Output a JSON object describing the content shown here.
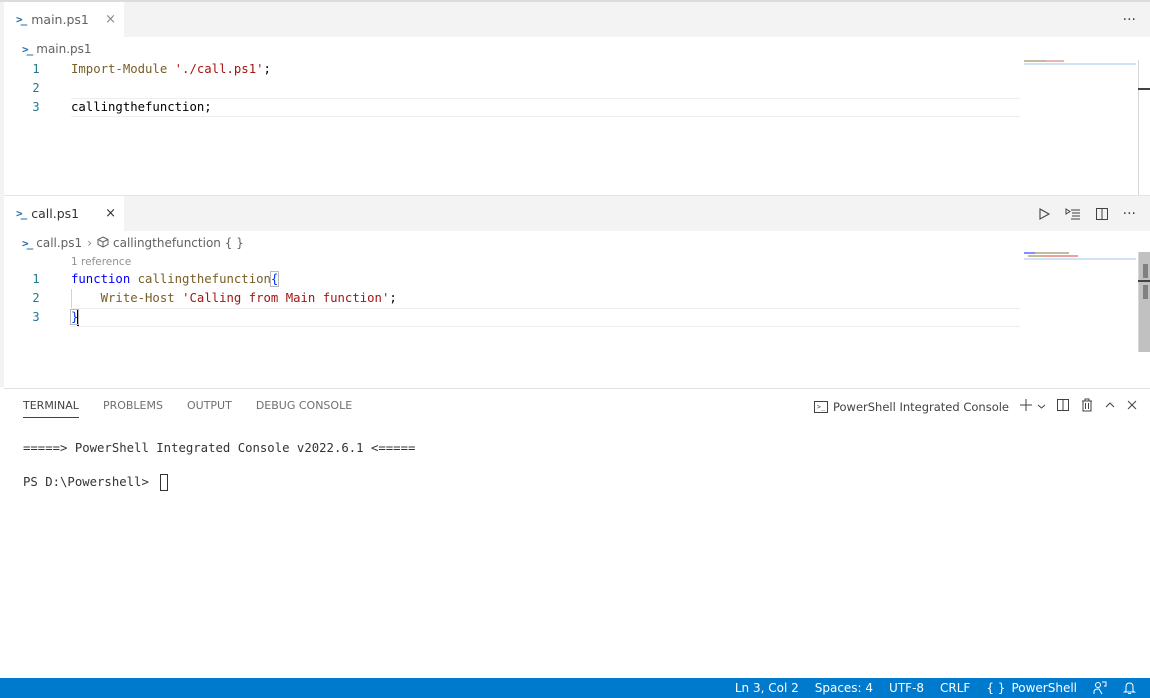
{
  "editor_groups": [
    {
      "tab": {
        "label": "main.ps1",
        "icon": "powershell-icon",
        "close": "×"
      },
      "actions": {
        "more": "···"
      },
      "breadcrumb": [
        {
          "label": "main.ps1",
          "icon": "powershell-icon"
        }
      ],
      "lines": [
        {
          "num": "1",
          "tokens": [
            {
              "t": "Import-Module ",
              "c": "cmd"
            },
            {
              "t": "'./call.ps1'",
              "c": "str"
            },
            {
              "t": ";",
              "c": "plain"
            }
          ]
        },
        {
          "num": "2",
          "tokens": []
        },
        {
          "num": "3",
          "tokens": [
            {
              "t": "callingthefunction;",
              "c": "plain"
            }
          ],
          "current": true
        }
      ]
    },
    {
      "tab": {
        "label": "call.ps1",
        "icon": "powershell-icon",
        "close": "×"
      },
      "actions": {
        "run": "▷",
        "run_selection": "run-selection",
        "split": "split",
        "more": "···"
      },
      "breadcrumb": [
        {
          "label": "call.ps1",
          "icon": "powershell-icon"
        },
        {
          "label": "callingthefunction { }",
          "icon": "symbol-function-icon"
        }
      ],
      "codelens": "1 reference",
      "lines": [
        {
          "num": "1",
          "tokens": [
            {
              "t": "function ",
              "c": "kw"
            },
            {
              "t": "callingthefunction",
              "c": "fn"
            },
            {
              "t": "{",
              "c": "brace"
            }
          ]
        },
        {
          "num": "2",
          "tokens": [
            {
              "t": "    Write-Host ",
              "c": "cmd"
            },
            {
              "t": "'Calling from Main function'",
              "c": "str"
            },
            {
              "t": ";",
              "c": "plain"
            }
          ]
        },
        {
          "num": "3",
          "tokens": [
            {
              "t": "}",
              "c": "brace"
            }
          ],
          "current": true,
          "cursor": true
        }
      ]
    }
  ],
  "panel": {
    "tabs": [
      "TERMINAL",
      "PROBLEMS",
      "OUTPUT",
      "DEBUG CONSOLE"
    ],
    "active_tab": "TERMINAL",
    "terminal_name": "PowerShell Integrated Console",
    "terminal_lines": [
      "=====> PowerShell Integrated Console v2022.6.1 <=====",
      "PS D:\\Powershell> "
    ]
  },
  "statusbar": {
    "position": "Ln 3, Col 2",
    "spaces": "Spaces: 4",
    "encoding": "UTF-8",
    "eol": "CRLF",
    "language": "PowerShell",
    "language_icon": "{ }"
  },
  "colors": {
    "statusbar": "#007acc",
    "keyword": "#0000ff",
    "function": "#795e26",
    "string": "#a31515",
    "line_number": "#237893"
  }
}
